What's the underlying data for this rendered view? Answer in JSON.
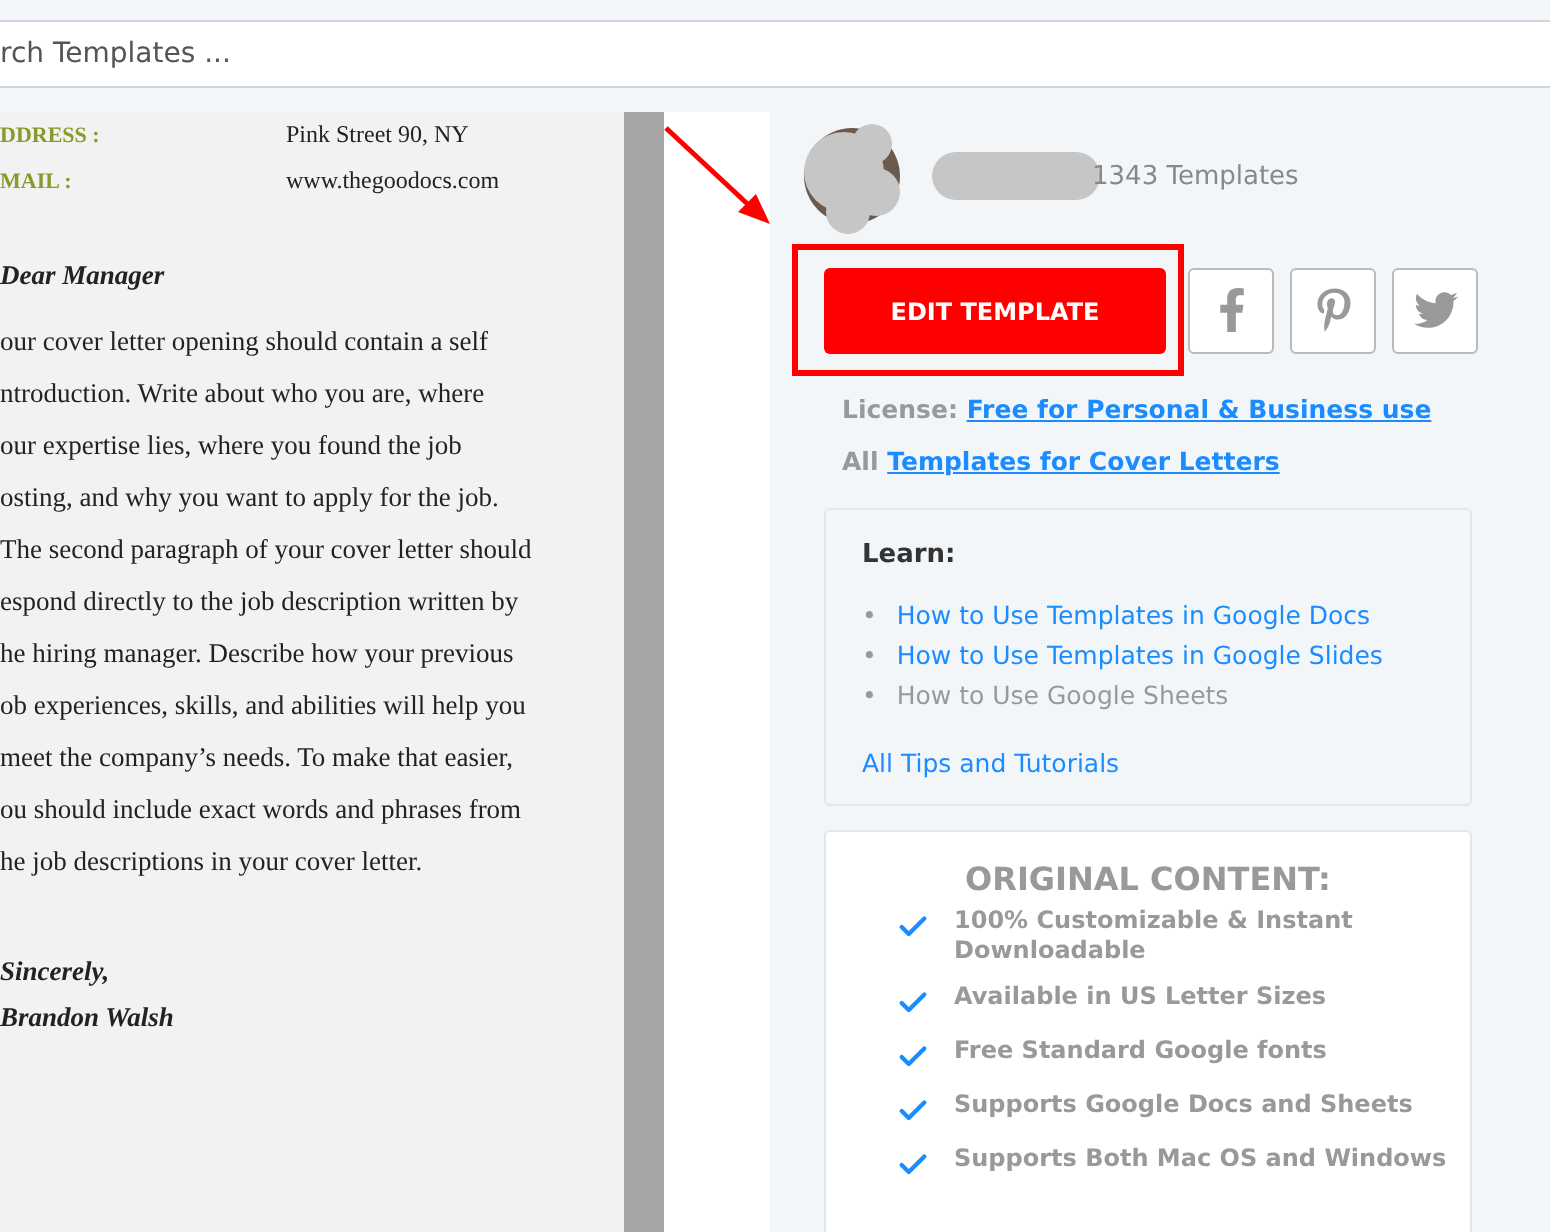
{
  "search": {
    "placeholder": "rch Templates ..."
  },
  "document": {
    "fields": [
      {
        "label": "DDRESS :",
        "value": "Pink Street 90, NY"
      },
      {
        "label": "MAIL :",
        "value": "www.thegoodocs.com"
      }
    ],
    "greeting": "Dear Manager",
    "lines": [
      "our cover letter opening should contain a self",
      "ntroduction. Write about who you are, where",
      "our expertise lies, where you found the job",
      "osting, and why you want to apply for the job.",
      "The second paragraph of your cover letter should",
      "espond directly to the job description written by",
      "he hiring manager. Describe how your previous",
      "ob experiences, skills, and abilities will help you",
      "meet the company’s needs. To make that easier,",
      "ou should include exact words and phrases from",
      "he job descriptions in your cover letter."
    ],
    "closing": "Sincerely,",
    "signature": "Brandon Walsh"
  },
  "author": {
    "count": "1343 Templates"
  },
  "edit_button": "EDIT TEMPLATE",
  "share": [
    {
      "kind": "facebook"
    },
    {
      "kind": "pinterest"
    },
    {
      "kind": "twitter"
    }
  ],
  "license": {
    "label": "License:",
    "link": "Free for Personal & Business use"
  },
  "all": {
    "label": "All",
    "link": "Templates for Cover Letters"
  },
  "learn": {
    "title": "Learn:",
    "items": [
      {
        "bullet": "•",
        "text": "How to Use Templates in Google Docs",
        "muted": false
      },
      {
        "bullet": "•",
        "text": "How to Use Templates in Google Slides",
        "muted": false
      },
      {
        "bullet": "•",
        "text": "How to Use Google Sheets",
        "muted": true
      }
    ],
    "footer": "All Tips and Tutorials"
  },
  "original": {
    "title": "ORIGINAL CONTENT:",
    "items": [
      "100% Customizable & Instant Downloadable",
      "Available in US Letter Sizes",
      "Free Standard Google fonts",
      "Supports Google Docs and Sheets",
      "Supports Both Mac OS and Windows"
    ]
  }
}
